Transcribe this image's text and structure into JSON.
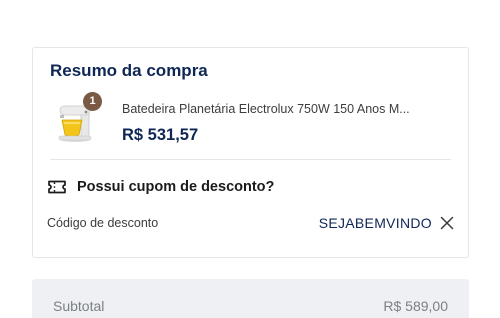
{
  "summary_card": {
    "title": "Resumo da compra",
    "product": {
      "quantity": "1",
      "name": "Batedeira Planetária Electrolux 750W 150 Anos M...",
      "price": "R$ 531,57",
      "thumbnail_icon": "stand-mixer-image"
    },
    "coupon": {
      "icon": "ticket-icon",
      "title": "Possui cupom de desconto?",
      "code_label": "Código de desconto",
      "code_value": "SEJABEMVINDO",
      "remove_icon": "close-icon"
    }
  },
  "totals": {
    "subtotal_label": "Subtotal",
    "subtotal_value": "R$ 589,00"
  },
  "colors": {
    "brand_navy": "#0f2755",
    "badge_brown": "#7a5a44",
    "border": "#e4e6ea",
    "summary_bg": "#eef0f3",
    "muted_text": "#7b8087"
  }
}
